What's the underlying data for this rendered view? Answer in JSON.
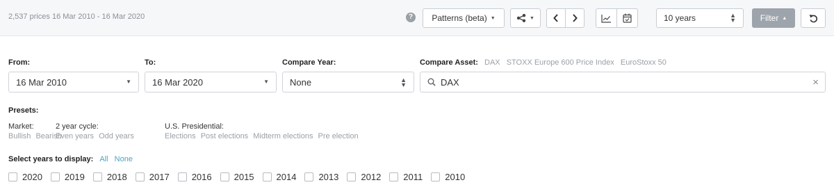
{
  "header": {
    "price_info": "2,537 prices  16 Mar 2010 - 16 Mar 2020",
    "patterns_label": "Patterns (beta)",
    "range_value": "10 years",
    "filter_label": "Filter"
  },
  "form": {
    "from": {
      "label": "From:",
      "value": "16 Mar 2010"
    },
    "to": {
      "label": "To:",
      "value": "16 Mar 2020"
    },
    "compare_year": {
      "label": "Compare Year:",
      "value": "None"
    },
    "compare_asset": {
      "label": "Compare Asset:",
      "suggestions": [
        "DAX",
        "STOXX Europe 600 Price Index",
        "EuroStoxx 50"
      ],
      "value": "DAX"
    }
  },
  "presets": {
    "label": "Presets:",
    "market": {
      "title": "Market:",
      "items": [
        "Bullish",
        "Bearish"
      ]
    },
    "cycle": {
      "title": "2 year cycle:",
      "items": [
        "Even years",
        "Odd years"
      ]
    },
    "presidential": {
      "title": "U.S. Presidential:",
      "items": [
        "Elections",
        "Post elections",
        "Midterm elections",
        "Pre election"
      ]
    }
  },
  "years": {
    "label": "Select years to display:",
    "all_label": "All",
    "none_label": "None",
    "items": [
      "2020",
      "2019",
      "2018",
      "2017",
      "2016",
      "2015",
      "2014",
      "2013",
      "2012",
      "2011",
      "2010"
    ]
  }
}
